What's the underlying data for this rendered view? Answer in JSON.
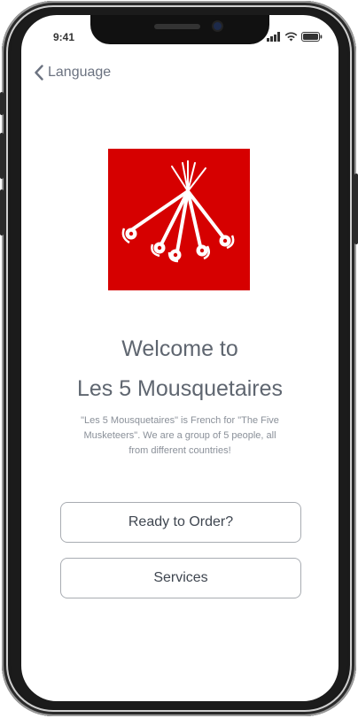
{
  "status_bar": {
    "time": "9:41"
  },
  "nav": {
    "back_label": "Language"
  },
  "brand": {
    "logo_color": "#d60000"
  },
  "welcome": {
    "line1": "Welcome to",
    "line2": "Les 5 Mousquetaires",
    "description": "\"Les 5 Mousquetaires\" is French for \"The Five Musketeers\". We are a group of 5 people, all from different countries!"
  },
  "actions": {
    "order_label": "Ready to Order?",
    "services_label": "Services"
  },
  "icons": [
    "back-chevron-icon",
    "signal-icon",
    "wifi-icon",
    "battery-icon",
    "crossed-swords-logo"
  ]
}
